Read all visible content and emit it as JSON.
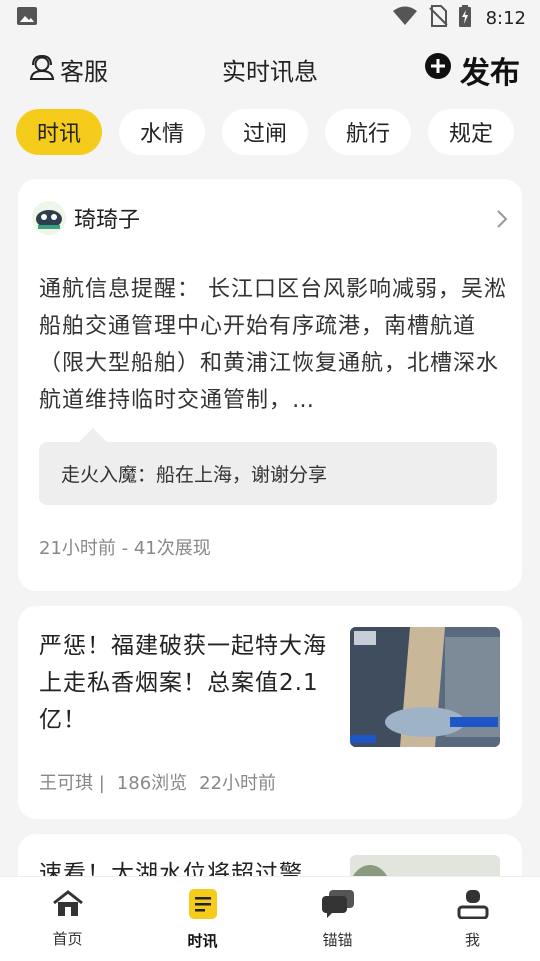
{
  "status_bar": {
    "time": "8:12"
  },
  "header": {
    "service_label": "客服",
    "title": "实时讯息",
    "publish_label": "发布"
  },
  "tabs": [
    {
      "label": "时讯",
      "active": true
    },
    {
      "label": "水情",
      "active": false
    },
    {
      "label": "过闸",
      "active": false
    },
    {
      "label": "航行",
      "active": false
    },
    {
      "label": "规定",
      "active": false
    }
  ],
  "post": {
    "author": "琦琦子",
    "text": "通航信息提醒： 长江口区台风影响减弱，吴淞船舶交通管理中心开始有序疏港，南槽航道（限大型船舶）和黄浦江恢复通航，北槽深水航道维持临时交通管制，…",
    "comment": "走火入魔：船在上海，谢谢分享",
    "meta": "21小时前 - 41次展现"
  },
  "news": {
    "title": "严惩！福建破获一起特大海上走私香烟案！总案值2.1亿！",
    "author": "王可琪 |",
    "views": "186浏览",
    "time": "22小时前"
  },
  "news2": {
    "title": "速看！太湖水位将超过警"
  },
  "bottom_nav": [
    {
      "label": "首页",
      "icon": "home-icon",
      "active": false
    },
    {
      "label": "时讯",
      "icon": "news-icon",
      "active": true
    },
    {
      "label": "锚锚",
      "icon": "chat-icon",
      "active": false
    },
    {
      "label": "我",
      "icon": "user-icon",
      "active": false
    }
  ],
  "colors": {
    "accent": "#f5cc1b",
    "background": "#f4f4f4"
  }
}
